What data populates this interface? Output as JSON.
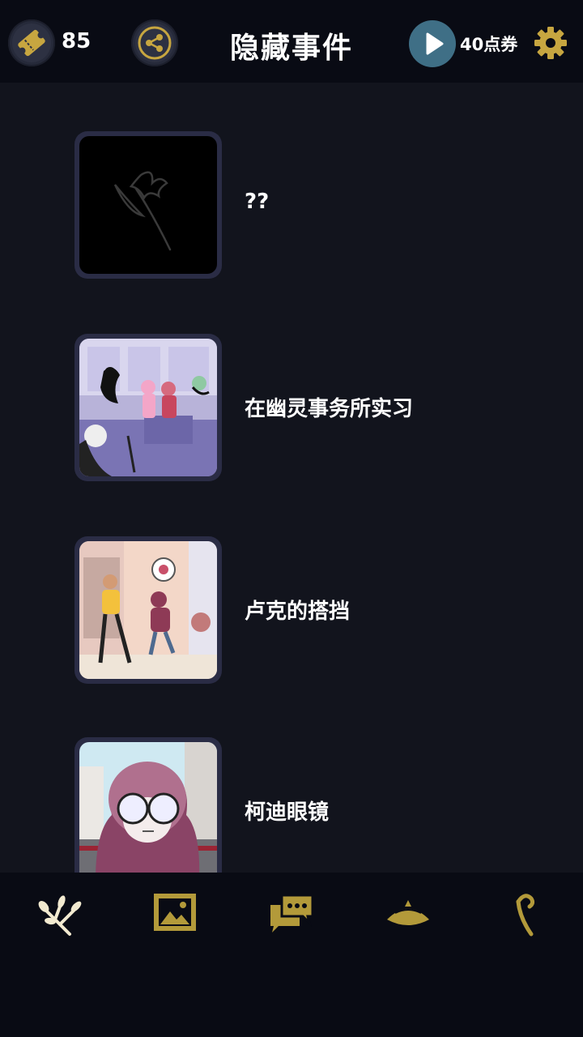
{
  "header": {
    "ticket_count": "85",
    "title": "隐藏事件",
    "points_label": "40点券"
  },
  "events": [
    {
      "label": "??",
      "thumb": "locked-silhouette"
    },
    {
      "label": "在幽灵事务所实习",
      "thumb": "ghost-office-scene"
    },
    {
      "label": "卢克的搭挡",
      "thumb": "street-scene"
    },
    {
      "label": "柯迪眼镜",
      "thumb": "glasses-portrait"
    }
  ],
  "nav": [
    {
      "icon": "branch-icon",
      "active": true
    },
    {
      "icon": "gallery-icon",
      "active": false
    },
    {
      "icon": "chat-icon",
      "active": false
    },
    {
      "icon": "hat-icon",
      "active": false
    },
    {
      "icon": "cane-icon",
      "active": false
    }
  ],
  "colors": {
    "accent": "#c7a640",
    "background": "#12141d",
    "header": "#090b14",
    "play": "#3f6f86"
  }
}
